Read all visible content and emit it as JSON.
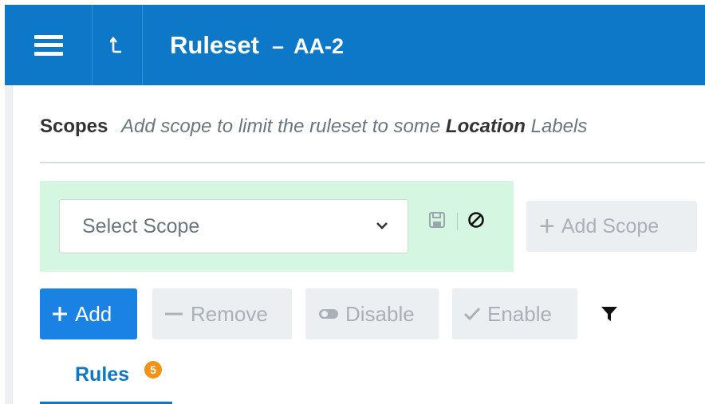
{
  "header": {
    "title": "Ruleset",
    "separator": "–",
    "ruleset_id": "AA-2",
    "menu_icon": "hamburger-menu-icon",
    "up_icon": "level-up-arrow-icon",
    "bg_color": "#0d78c7"
  },
  "scopes": {
    "label": "Scopes",
    "hint_prefix": "Add scope to limit the ruleset to some",
    "hint_emphasis": "Location",
    "hint_suffix": "Labels",
    "select_placeholder": "Select Scope",
    "save_icon": "save-icon",
    "cancel_icon": "cancel-icon",
    "add_scope_label": "Add Scope",
    "box_color": "#d5f7e1"
  },
  "toolbar": {
    "add_label": "Add",
    "remove_label": "Remove",
    "disable_label": "Disable",
    "enable_label": "Enable",
    "filter_icon": "filter-icon",
    "primary_color": "#1a82e2"
  },
  "tabs": [
    {
      "label": "Rules",
      "count": "5",
      "active": true
    }
  ],
  "badge_color": "#f29313"
}
